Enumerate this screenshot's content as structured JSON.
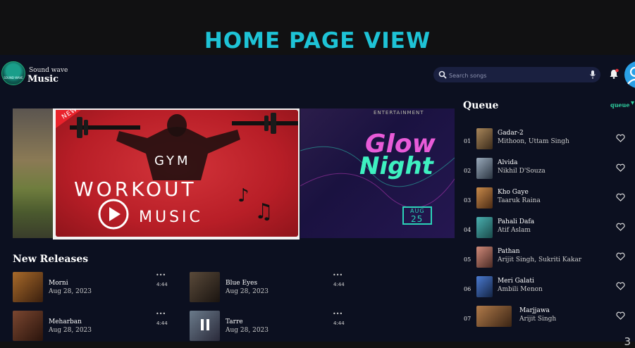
{
  "slide": {
    "title": "HOME PAGE VIEW",
    "page_number": "3"
  },
  "header": {
    "brand_line1": "Sound wave",
    "brand_line2": "Music",
    "logo_text": "SOUND WAVE",
    "search_placeholder": "Search songs",
    "icons": [
      "search-icon",
      "microphone-icon",
      "bell-icon",
      "avatar"
    ]
  },
  "carousel": {
    "main_banner": {
      "line1": "GYM",
      "line2": "WORKOUT",
      "line3": "MUSIC",
      "ribbon": "NEW"
    },
    "right_banner": {
      "top": "ENTERTAINMENT",
      "line1": "Glow",
      "line2": "Night",
      "badge_month": "AUG",
      "badge_day": "25"
    }
  },
  "new_releases": {
    "title": "New Releases",
    "items": [
      {
        "name": "Morni",
        "date": "Aug 28, 2023",
        "duration": "4:44",
        "color": "#7a4a1c"
      },
      {
        "name": "Blue Eyes",
        "date": "Aug 28, 2023",
        "duration": "4:44",
        "color": "#3b3128"
      },
      {
        "name": "Meharban",
        "date": "Aug 28, 2023",
        "duration": "4:44",
        "color": "#5c3320"
      },
      {
        "name": "Tarre",
        "date": "Aug 28, 2023",
        "duration": "4:44",
        "color": "#4a5a6a"
      }
    ]
  },
  "queue": {
    "title": "Queue",
    "link": "queue",
    "items": [
      {
        "num": "01",
        "title": "Gadar-2",
        "artist": "Mithoon, Uttam Singh",
        "color": "#8a6a4a"
      },
      {
        "num": "02",
        "title": "Alvida",
        "artist": "Nikhil D'Souza",
        "color": "#6b7b8c"
      },
      {
        "num": "03",
        "title": "Kho Gaye",
        "artist": "Taaruk Raina",
        "color": "#9a6a3a"
      },
      {
        "num": "04",
        "title": "Pahali Dafa",
        "artist": "Atif Aslam",
        "color": "#3a8a8a"
      },
      {
        "num": "05",
        "title": "Pathan",
        "artist": "Arijit Singh, Sukriti Kakar",
        "color": "#a86a5a"
      },
      {
        "num": "06",
        "title": "Meri Galati",
        "artist": "Ambili Menon",
        "color": "#2a4a8a"
      },
      {
        "num": "07",
        "title": "Marjjawa",
        "artist": "Arijit Singh",
        "color": "#8a5a3a"
      }
    ]
  }
}
